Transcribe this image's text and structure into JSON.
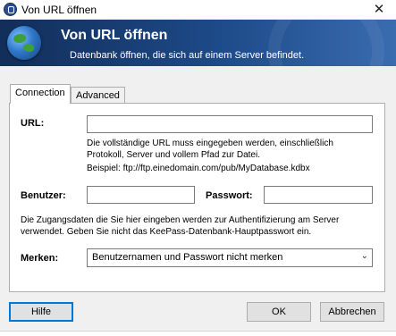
{
  "window": {
    "title": "Von URL öffnen",
    "close_glyph": "✕"
  },
  "banner": {
    "heading": "Von URL öffnen",
    "subheading": "Datenbank öffnen, die sich auf einem Server befindet.",
    "icon": "globe-icon"
  },
  "tabs": [
    {
      "label": "Connection",
      "active": true
    },
    {
      "label": "Advanced",
      "active": false
    }
  ],
  "form": {
    "url_label": "URL:",
    "url_value": "",
    "url_help": "Die vollständige URL muss eingegeben werden, einschließlich Protokoll, Server und vollem Pfad zur Datei.",
    "url_example": "Beispiel: ftp://ftp.einedomain.com/pub/MyDatabase.kdbx",
    "user_label": "Benutzer:",
    "user_value": "",
    "password_label": "Passwort:",
    "password_value": "",
    "credentials_info": "Die Zugangsdaten die Sie hier eingeben werden zur Authentifizierung am Server verwendet. Geben Sie nicht das KeePass-Datenbank-Hauptpasswort ein.",
    "remember_label": "Merken:",
    "remember_selected": "Benutzernamen und Passwort nicht merken"
  },
  "buttons": {
    "help": "Hilfe",
    "ok": "OK",
    "cancel": "Abbrechen"
  },
  "colors": {
    "banner_dark": "#122e5a",
    "banner_light": "#3a6cb0",
    "focus_blue": "#0078d7"
  }
}
